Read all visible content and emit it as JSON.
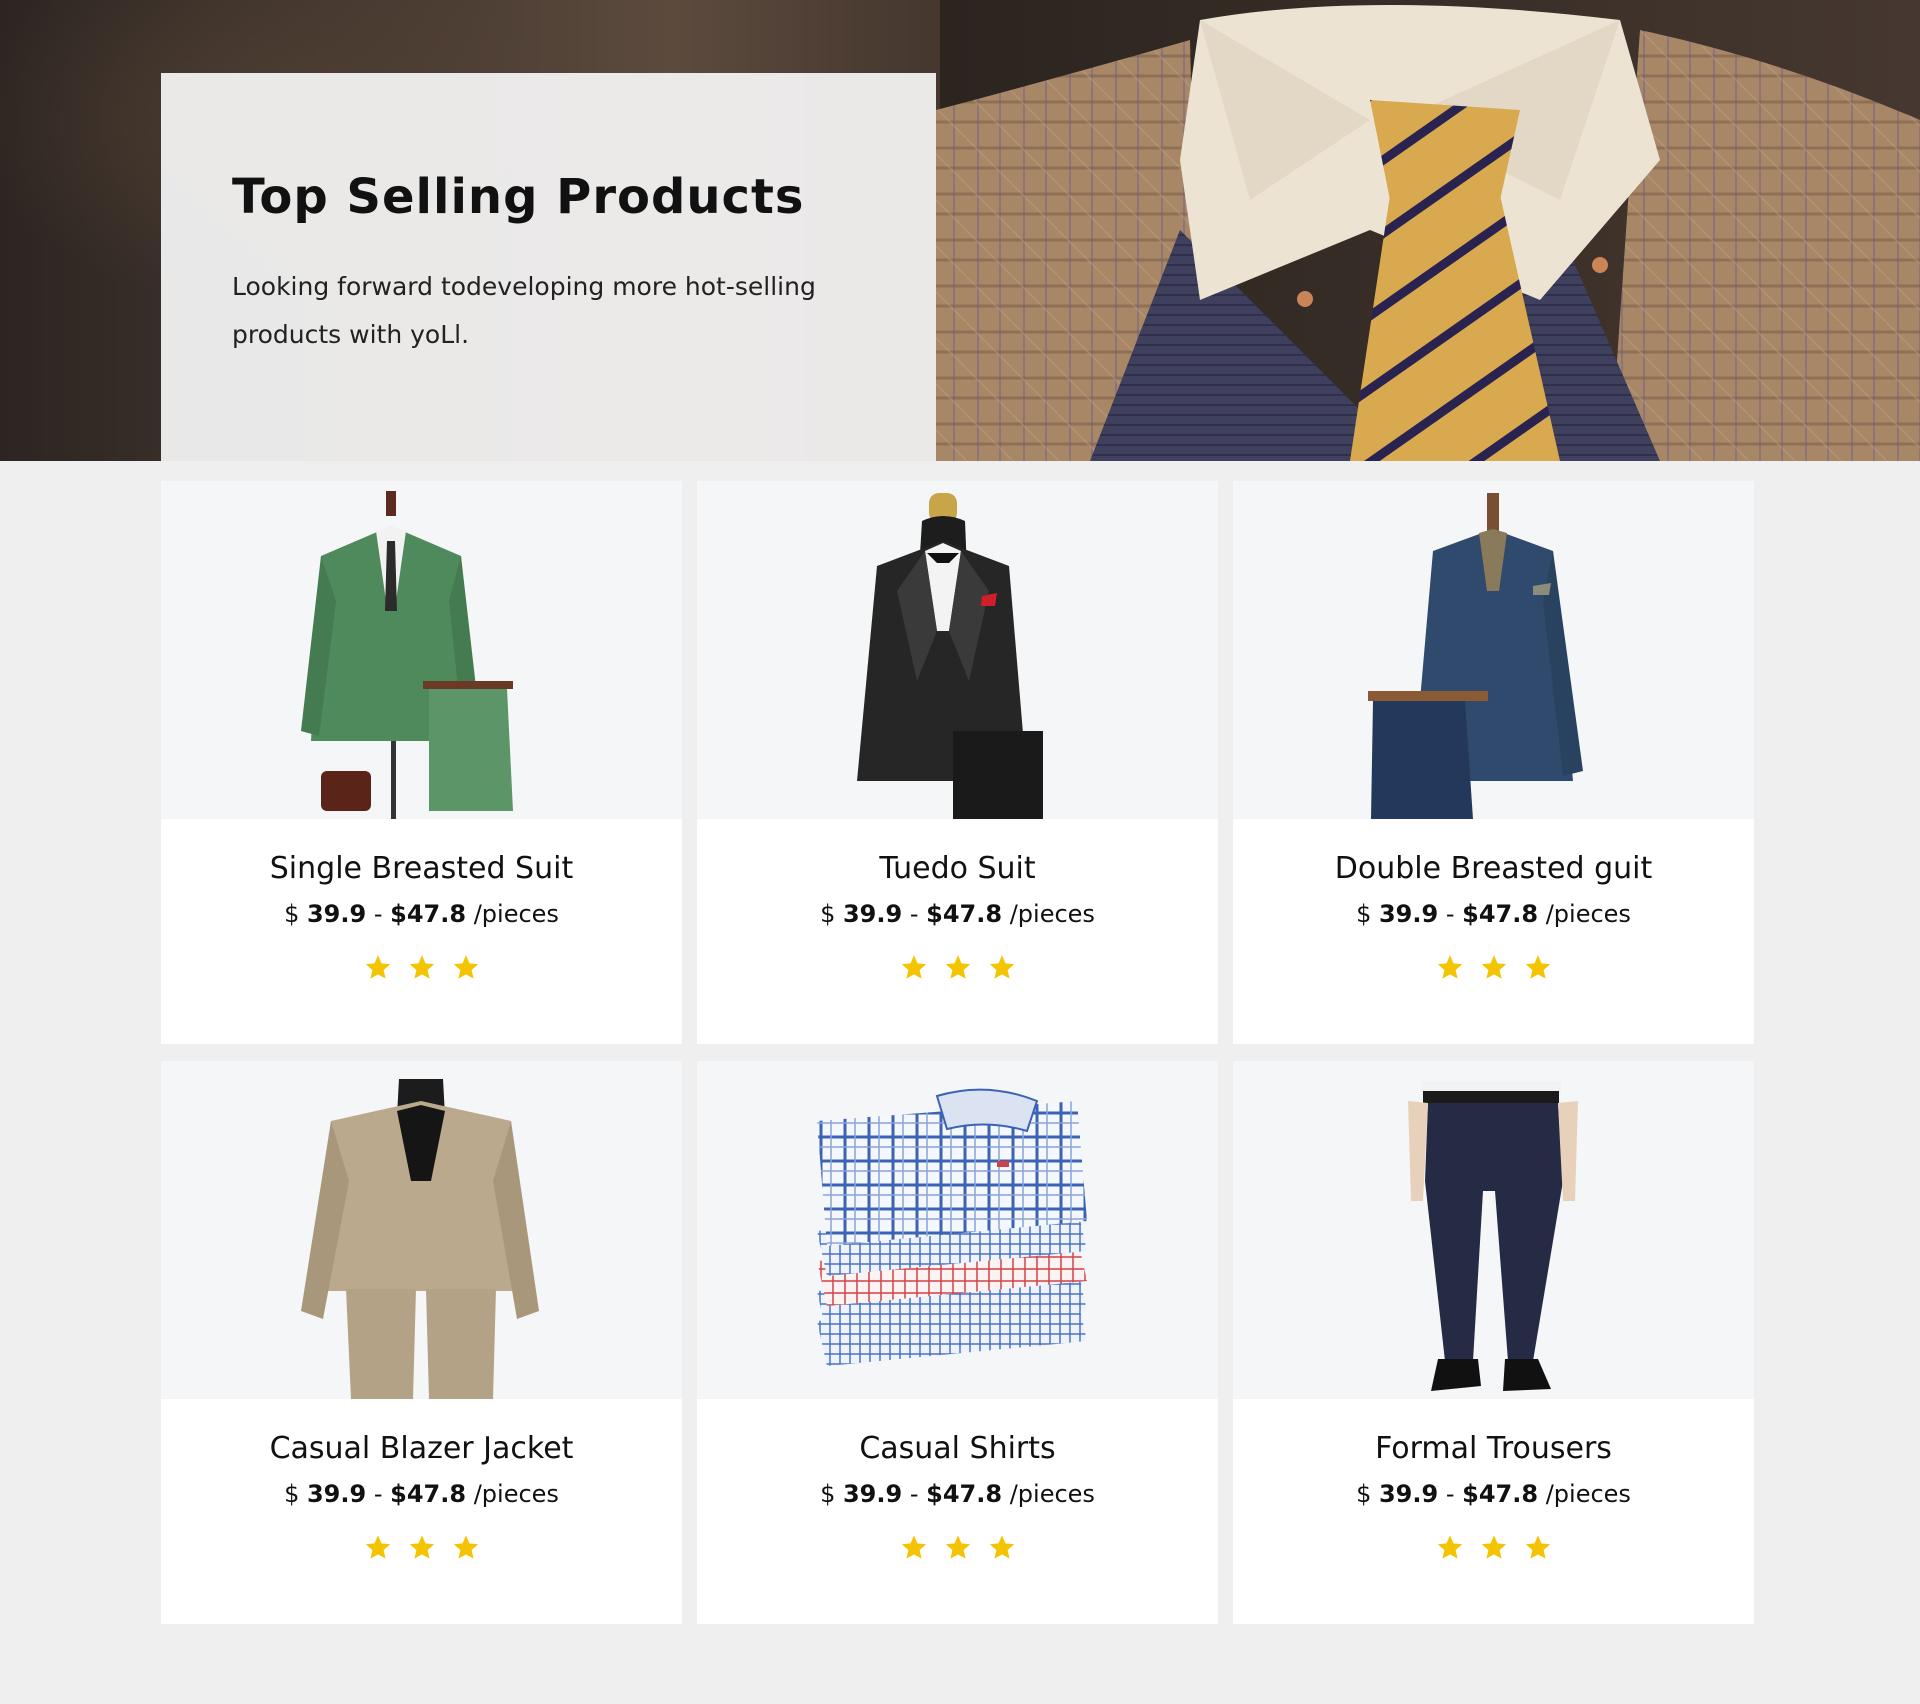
{
  "hero": {
    "title": "Top  Selling  Products",
    "description": "Looking forward todeveloping more hot-selling products with yoLl.",
    "image": "mannequin-tweed-jacket-gold-tie-photo"
  },
  "products": [
    {
      "name": "Single Breasted Suit",
      "currency": "$",
      "price_min": "39.9",
      "price_max": "$47.8",
      "unit": "/pieces",
      "rating": 3,
      "image": "green-single-breasted-suit-photo"
    },
    {
      "name": "Tuedo Suit",
      "currency": "$",
      "price_min": "39.9",
      "price_max": "$47.8",
      "unit": "/pieces",
      "rating": 3,
      "image": "black-tuxedo-suit-photo"
    },
    {
      "name": "Double Breasted guit",
      "currency": "$",
      "price_min": "39.9",
      "price_max": "$47.8",
      "unit": "/pieces",
      "rating": 3,
      "image": "navy-double-breasted-suit-photo"
    },
    {
      "name": "Casual Blazer Jacket",
      "currency": "$",
      "price_min": "39.9",
      "price_max": "$47.8",
      "unit": "/pieces",
      "rating": 3,
      "image": "beige-casual-blazer-photo"
    },
    {
      "name": "Casual Shirts",
      "currency": "$",
      "price_min": "39.9",
      "price_max": "$47.8",
      "unit": "/pieces",
      "rating": 3,
      "image": "folded-check-shirts-photo"
    },
    {
      "name": "Formal Trousers",
      "currency": "$",
      "price_min": "39.9",
      "price_max": "$47.8",
      "unit": "/pieces",
      "rating": 3,
      "image": "navy-formal-trousers-photo"
    }
  ],
  "colors": {
    "page_background": "#efefef",
    "card_background": "#ffffff",
    "image_background": "#f4f6f7",
    "star": "#f5c400",
    "text": "#111111"
  }
}
